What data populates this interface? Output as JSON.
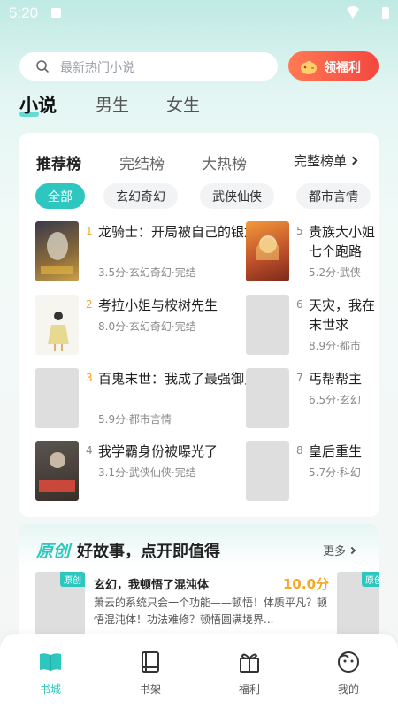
{
  "status": {
    "time": "5:20"
  },
  "search": {
    "placeholder": "最新热门小说"
  },
  "welfare_button": {
    "label": "领福利"
  },
  "top_tabs": [
    "小说",
    "男生",
    "女生"
  ],
  "rank_tabs": [
    "推荐榜",
    "完结榜",
    "大热榜"
  ],
  "rank_more": "完整榜单",
  "categories": [
    "全部",
    "玄幻奇幻",
    "武侠仙侠",
    "都市言情"
  ],
  "books": [
    {
      "rank": "1",
      "title": "龙骑士：开局被自己的银龙反骑",
      "meta": "3.5分·玄幻奇幻·完结"
    },
    {
      "rank": "2",
      "title": "考拉小姐与桉树先生",
      "meta": "8.0分·玄幻奇幻·完结"
    },
    {
      "rank": "3",
      "title": "百鬼末世：我成了最强御鬼师",
      "meta": "5.9分·都市言情"
    },
    {
      "rank": "4",
      "title": "我学霸身份被曝光了",
      "meta": "3.1分·武侠仙侠·完结"
    },
    {
      "rank": "5",
      "title": "贵族大小姐七个跑路",
      "meta": "5.2分·武侠"
    },
    {
      "rank": "6",
      "title": "天灾，我在末世求",
      "meta": "8.9分·都市"
    },
    {
      "rank": "7",
      "title": "丐帮帮主",
      "meta": "6.5分·玄幻"
    },
    {
      "rank": "8",
      "title": "皇后重生",
      "meta": "5.7分·科幻"
    }
  ],
  "original": {
    "brand": "原创",
    "slogan": "好故事，点开即值得",
    "more": "更多",
    "badge": "原创",
    "title": "玄幻，我顿悟了混沌体",
    "score": "10.0分",
    "desc": "萧云的系统只会一个功能——顿悟！体质平凡？顿悟混沌体！功法难修？顿悟圆满境界..."
  },
  "nav": [
    "书城",
    "书架",
    "福利",
    "我的"
  ],
  "colors": {
    "accent": "#2ec7bf",
    "welfare": "#f4473f",
    "rank_gold": "#f5a623"
  }
}
